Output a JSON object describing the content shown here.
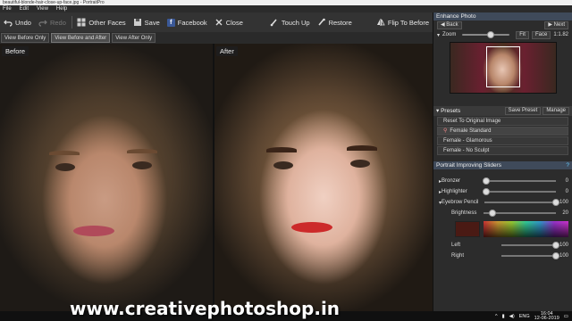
{
  "window": {
    "title": "beautiful-blonde-hair-close-up-face.jpg - PortraitPro"
  },
  "menu": [
    "File",
    "Edit",
    "View",
    "Help"
  ],
  "toolbar": {
    "undo": "Undo",
    "redo": "Redo",
    "other_faces": "Other Faces",
    "save": "Save",
    "facebook": "Facebook",
    "close": "Close",
    "touch_up": "Touch Up",
    "restore": "Restore",
    "flip": "Flip To Before"
  },
  "view_tabs": [
    "View Before Only",
    "View Before and After",
    "View After Only"
  ],
  "active_view": 1,
  "before_label": "Before",
  "after_label": "After",
  "panel": {
    "title": "Enhance Photo",
    "back": "Back",
    "next": "Next",
    "zoom_label": "Zoom",
    "fit": "Fit",
    "face": "Face",
    "ratio": "1:1.82"
  },
  "presets": {
    "title": "Presets",
    "save": "Save Preset",
    "manage": "Manage",
    "items": [
      "Reset To Original Image",
      "Female Standard",
      "Female - Glamorous",
      "Female - No Sculpt"
    ]
  },
  "sliders": {
    "title": "Portrait Improving Sliders",
    "rows": [
      {
        "name": "Bronzer",
        "value": "0"
      },
      {
        "name": "Highlighter",
        "value": "0"
      },
      {
        "name": "Eyebrow Pencil",
        "value": "100"
      }
    ],
    "brightness": {
      "name": "Brightness",
      "value": "20"
    },
    "left": {
      "name": "Left",
      "value": "100"
    },
    "right": {
      "name": "Right",
      "value": "100"
    }
  },
  "watermark": "www.creativephotoshop.in",
  "tray": {
    "lang": "ENG",
    "time": "16:04",
    "date": "12-06-2019"
  },
  "colors": {
    "accent": "#3f4a5a",
    "lipstick": "#cc2a2a",
    "facebook": "#3b5998"
  }
}
